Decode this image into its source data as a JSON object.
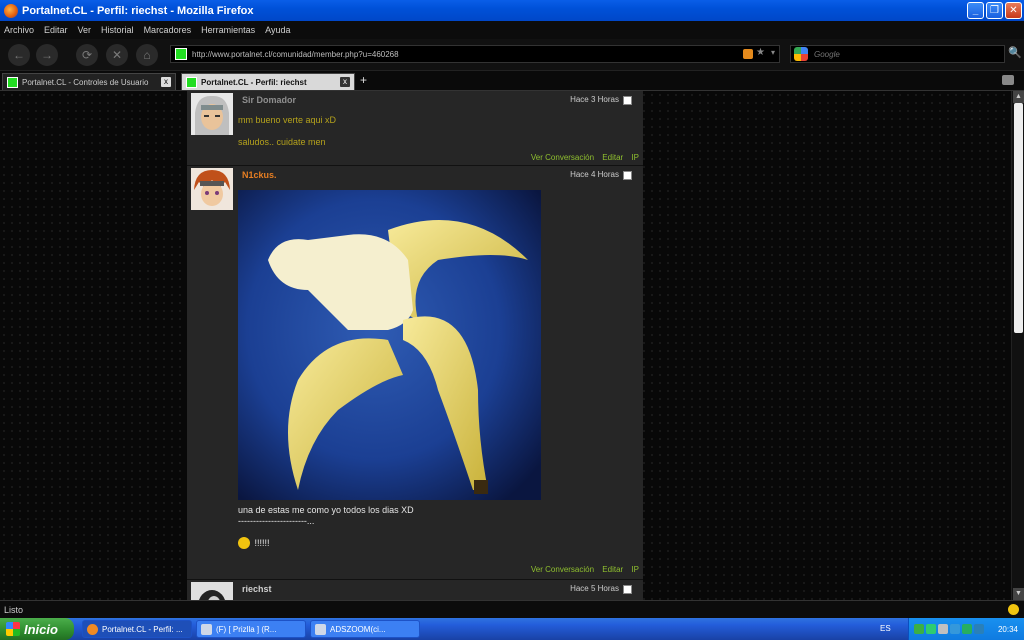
{
  "window": {
    "title": "Portalnet.CL - Perfil: riechst - Mozilla Firefox",
    "min_label": "_",
    "max_label": "❐",
    "close_label": "✕"
  },
  "menubar": {
    "items": [
      "Archivo",
      "Editar",
      "Ver",
      "Historial",
      "Marcadores",
      "Herramientas",
      "Ayuda"
    ]
  },
  "navbar": {
    "back_icon": "←",
    "forward_icon": "→",
    "reload_icon": "⟳",
    "stop_icon": "✕",
    "home_icon": "⌂",
    "url": "http://www.portalnet.cl/comunidad/member.php?u=460268",
    "star_icon": "★",
    "drop_icon": "▾",
    "search_placeholder": "Google",
    "search_icon": "🔍"
  },
  "tabs": [
    {
      "label": "Portalnet.CL - Controles de Usuario",
      "close": "x"
    },
    {
      "label": "Portalnet.CL - Perfil: riechst",
      "close": "x"
    }
  ],
  "newtab": "+",
  "comments": [
    {
      "author": "Sir Domador",
      "author_color": "#8f8f8f",
      "time": "Hace 3 Horas",
      "lines": [
        "mm bueno verte aqui xD",
        "saludos.. cuidate men"
      ],
      "actions": [
        "Ver Conversación",
        "Editar",
        "IP"
      ]
    },
    {
      "author": "N1ckus.",
      "author_color": "#e67e22",
      "time": "Hace 4 Horas",
      "text1": "una de estas me como yo todos los dias XD",
      "text2": "-----------------------...",
      "text3": " !!!!!!",
      "actions": [
        "Ver Conversación",
        "Editar",
        "IP"
      ]
    },
    {
      "author": "riechst",
      "author_color": "#cfcfcf",
      "time": "Hace 5 Horas"
    }
  ],
  "scroll": {
    "up": "▲",
    "down": "▼"
  },
  "status": {
    "text": "Listo"
  },
  "taskbar": {
    "start_label": "Inicio",
    "tasks": [
      "Portalnet.CL - Perfil: ...",
      "(F) [ Prizlla ] (R...",
      "ADSZOOM(ci..."
    ],
    "lang": "ES",
    "clock": "20:34"
  }
}
